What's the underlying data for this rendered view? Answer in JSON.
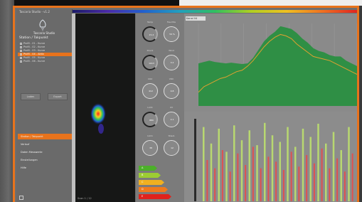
{
  "app": {
    "title": "Tascaria Studio - v1.2"
  },
  "sidebar": {
    "logo_text": "Tascaria Studio",
    "section1_title": "Station / Takpunkt",
    "list_items": [
      {
        "label": "Profil - 01 - Kurve",
        "selected": false
      },
      {
        "label": "Profil - 02 - Kurve",
        "selected": false
      },
      {
        "label": "Profil - 03 - Kurve",
        "selected": false
      },
      {
        "label": "Profil - 04 - Aktiv",
        "selected": true
      },
      {
        "label": "Profil - 05 - Kurve",
        "selected": false
      },
      {
        "label": "Profil - 06 - Kurve",
        "selected": false
      }
    ],
    "buttons": {
      "left": "Laden",
      "right": "Export"
    },
    "nav_items": [
      {
        "label": "Station / Takpunkt",
        "selected": true
      },
      {
        "label": "Verlauf",
        "selected": false
      },
      {
        "label": "Daten Messwerte",
        "selected": false
      },
      {
        "label": "Einstellungen",
        "selected": false
      },
      {
        "label": "Hilfe",
        "selected": false
      }
    ]
  },
  "heatmap": {
    "caption": "Scan 1 / 12"
  },
  "gauges": [
    {
      "label": "Temp",
      "value": "21.4",
      "style": "dark"
    },
    {
      "label": "Feuchte",
      "value": "54 %",
      "style": "ring"
    },
    {
      "label": "Druck",
      "value": "1013",
      "style": "dark"
    },
    {
      "label": "Wind",
      "value": "3.2",
      "style": "ring"
    },
    {
      "label": "CO2",
      "value": "412",
      "style": "ring"
    },
    {
      "label": "VOC",
      "value": "0.8",
      "style": "ring"
    },
    {
      "label": "Licht",
      "value": "880",
      "style": "dark"
    },
    {
      "label": "UV",
      "value": "2.1",
      "style": "ring"
    },
    {
      "label": "Lärm",
      "value": "38",
      "style": "ring"
    },
    {
      "label": "Staub",
      "value": "12",
      "style": "ring"
    }
  ],
  "energy_labels": [
    {
      "label": "A",
      "color": "#4caf2a"
    },
    {
      "label": "B",
      "color": "#9ccc33"
    },
    {
      "label": "C",
      "color": "#f0b020"
    },
    {
      "label": "D",
      "color": "#f07a1c"
    },
    {
      "label": "E",
      "color": "#e0221c"
    }
  ],
  "colors": {
    "accent": "#e8731c",
    "area_fill": "#2f8f45",
    "line": "#e0a030",
    "bar_green": "#b8d870",
    "bar_red": "#e05050"
  },
  "chart_top": {
    "tag": "Kanal 04"
  },
  "chart_data": [
    {
      "type": "area",
      "x": [
        0,
        1,
        2,
        3,
        4,
        5,
        6,
        7,
        8,
        9,
        10,
        11,
        12,
        13,
        14,
        15,
        16,
        17,
        18,
        19,
        20,
        21,
        22,
        23,
        24,
        25,
        26,
        27,
        28,
        29
      ],
      "series": [
        {
          "values": [
            62,
            64,
            66,
            64,
            63,
            62,
            63,
            62,
            61,
            62,
            70,
            82,
            94,
            102,
            108,
            116,
            114,
            112,
            106,
            98,
            92,
            84,
            80,
            78,
            74,
            72,
            72,
            66,
            62,
            58
          ]
        },
        {
          "values": [
            20,
            28,
            32,
            36,
            40,
            42,
            46,
            50,
            52,
            58,
            66,
            76,
            86,
            94,
            100,
            104,
            102,
            98,
            90,
            84,
            78,
            72,
            70,
            68,
            66,
            62,
            58,
            54,
            50,
            46
          ]
        }
      ],
      "ylim": [
        0,
        120
      ]
    },
    {
      "type": "bar",
      "series": [
        {
          "values": [
            90,
            70,
            88,
            60,
            92,
            74,
            86,
            68,
            95,
            80,
            72,
            90,
            66,
            88,
            78,
            94,
            70,
            84,
            62,
            90
          ]
        },
        {
          "values": [
            50,
            40,
            62,
            36,
            58,
            44,
            66,
            40,
            54,
            48,
            38,
            60,
            42,
            56,
            46,
            64,
            40,
            52,
            36,
            58
          ]
        }
      ],
      "ylim": [
        0,
        100
      ]
    }
  ]
}
